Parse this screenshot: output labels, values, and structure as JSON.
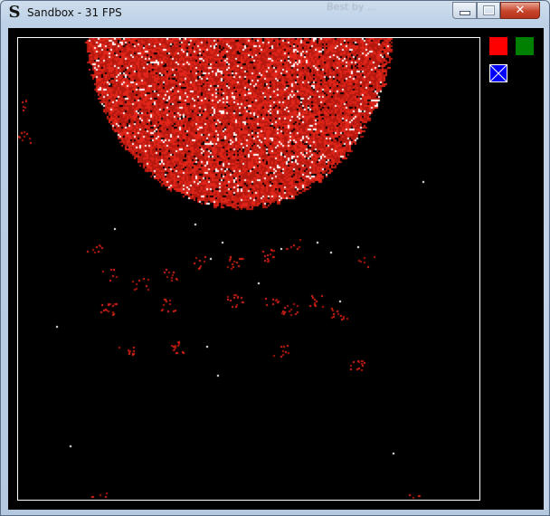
{
  "window": {
    "title": "Sandbox - 31 FPS",
    "app_icon_glyph": "S",
    "background_window_text": "Best by ..."
  },
  "controls": {
    "minimize_icon": "minimize-icon",
    "maximize_icon": "maximize-icon",
    "close_glyph": "✕"
  },
  "palette": {
    "background": "#000000",
    "sand": "#e0251a",
    "sand_dark": "#b5180f",
    "grain_highlight": "#ffffff",
    "canvas_border": "#ffffff"
  },
  "tools": [
    {
      "name": "red-material-swatch",
      "color": "#ff0000",
      "selected": false
    },
    {
      "name": "green-material-swatch",
      "color": "#008000",
      "selected": false
    },
    {
      "name": "eraser-swatch",
      "color": "#0000ff",
      "selected": false
    }
  ]
}
